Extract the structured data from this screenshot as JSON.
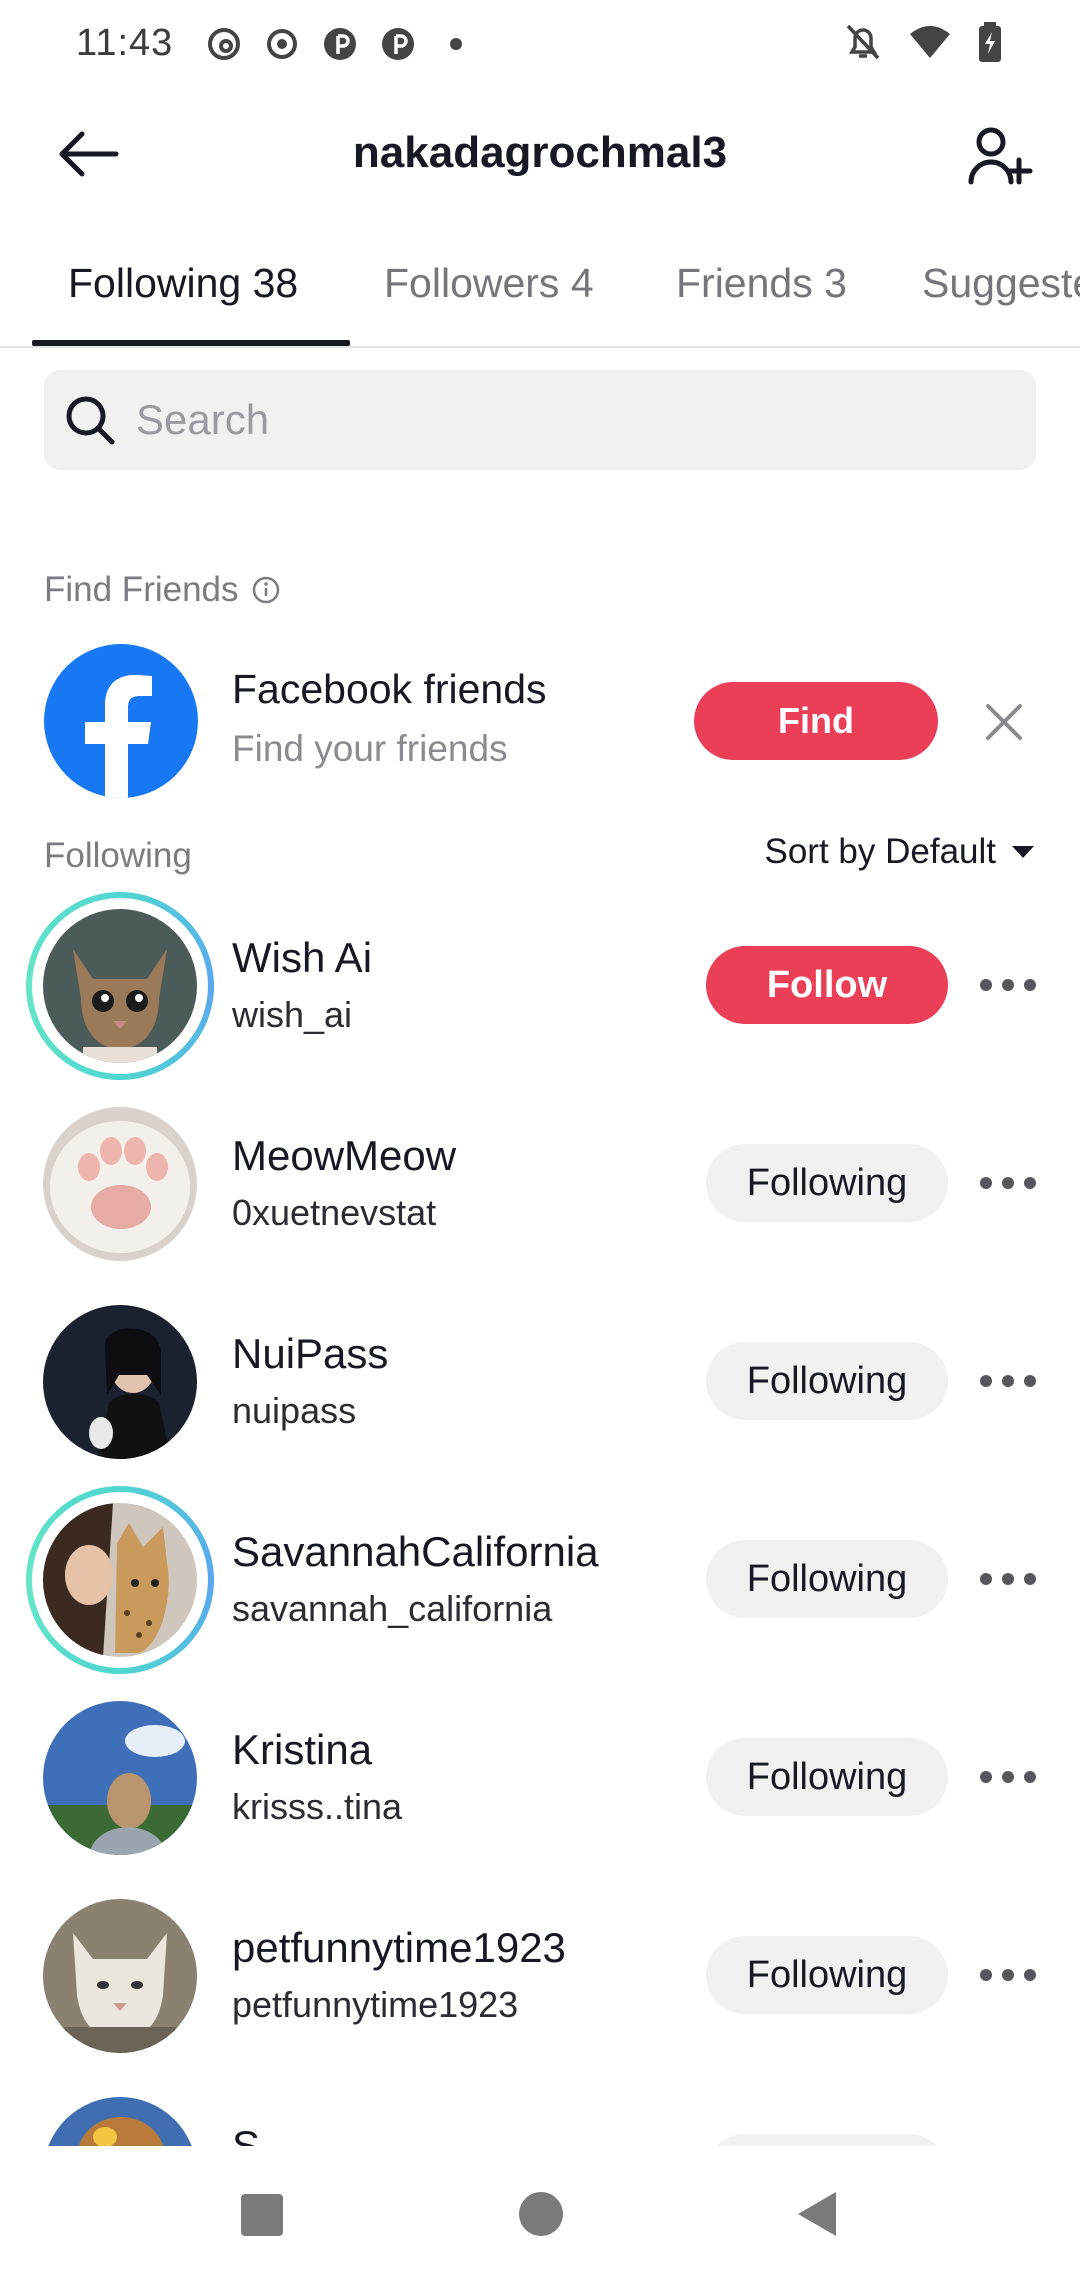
{
  "status_bar": {
    "time": "11:43",
    "left_icons": [
      "threads-icon",
      "record-icon",
      "pinterest-icon",
      "pinterest-icon",
      "dot-icon"
    ],
    "right_icons": [
      "bell-off-icon",
      "wifi-icon",
      "battery-charging-icon"
    ]
  },
  "header": {
    "title": "nakadagrochmal3"
  },
  "tabs": [
    {
      "label": "Following 38",
      "active": true
    },
    {
      "label": "Followers 4",
      "active": false
    },
    {
      "label": "Friends 3",
      "active": false
    },
    {
      "label": "Suggested",
      "active": false
    }
  ],
  "search": {
    "placeholder": "Search"
  },
  "find_friends": {
    "label": "Find Friends",
    "facebook": {
      "name": "Facebook friends",
      "subtitle": "Find your friends",
      "button": "Find"
    }
  },
  "following_section": {
    "label": "Following",
    "sort_label": "Sort by Default"
  },
  "users": [
    {
      "name": "Wish Ai",
      "handle": "wish_ai",
      "button": "Follow",
      "story_ring": true
    },
    {
      "name": "MeowMeow",
      "handle": "0xuetnevstat",
      "button": "Following",
      "story_ring": false
    },
    {
      "name": "NuiPass",
      "handle": "nuipass",
      "button": "Following",
      "story_ring": false
    },
    {
      "name": "SavannahCalifornia",
      "handle": "savannah_california",
      "button": "Following",
      "story_ring": true
    },
    {
      "name": "Kristina",
      "handle": "krisss..tina",
      "button": "Following",
      "story_ring": false
    },
    {
      "name": "petfunnytime1923",
      "handle": "petfunnytime1923",
      "button": "Following",
      "story_ring": false
    },
    {
      "name": "S",
      "handle": "",
      "button": "",
      "story_ring": false
    }
  ],
  "colors": {
    "accent": "#ea3f57",
    "facebook": "#1877f2",
    "ring": "#4fd6d0"
  }
}
